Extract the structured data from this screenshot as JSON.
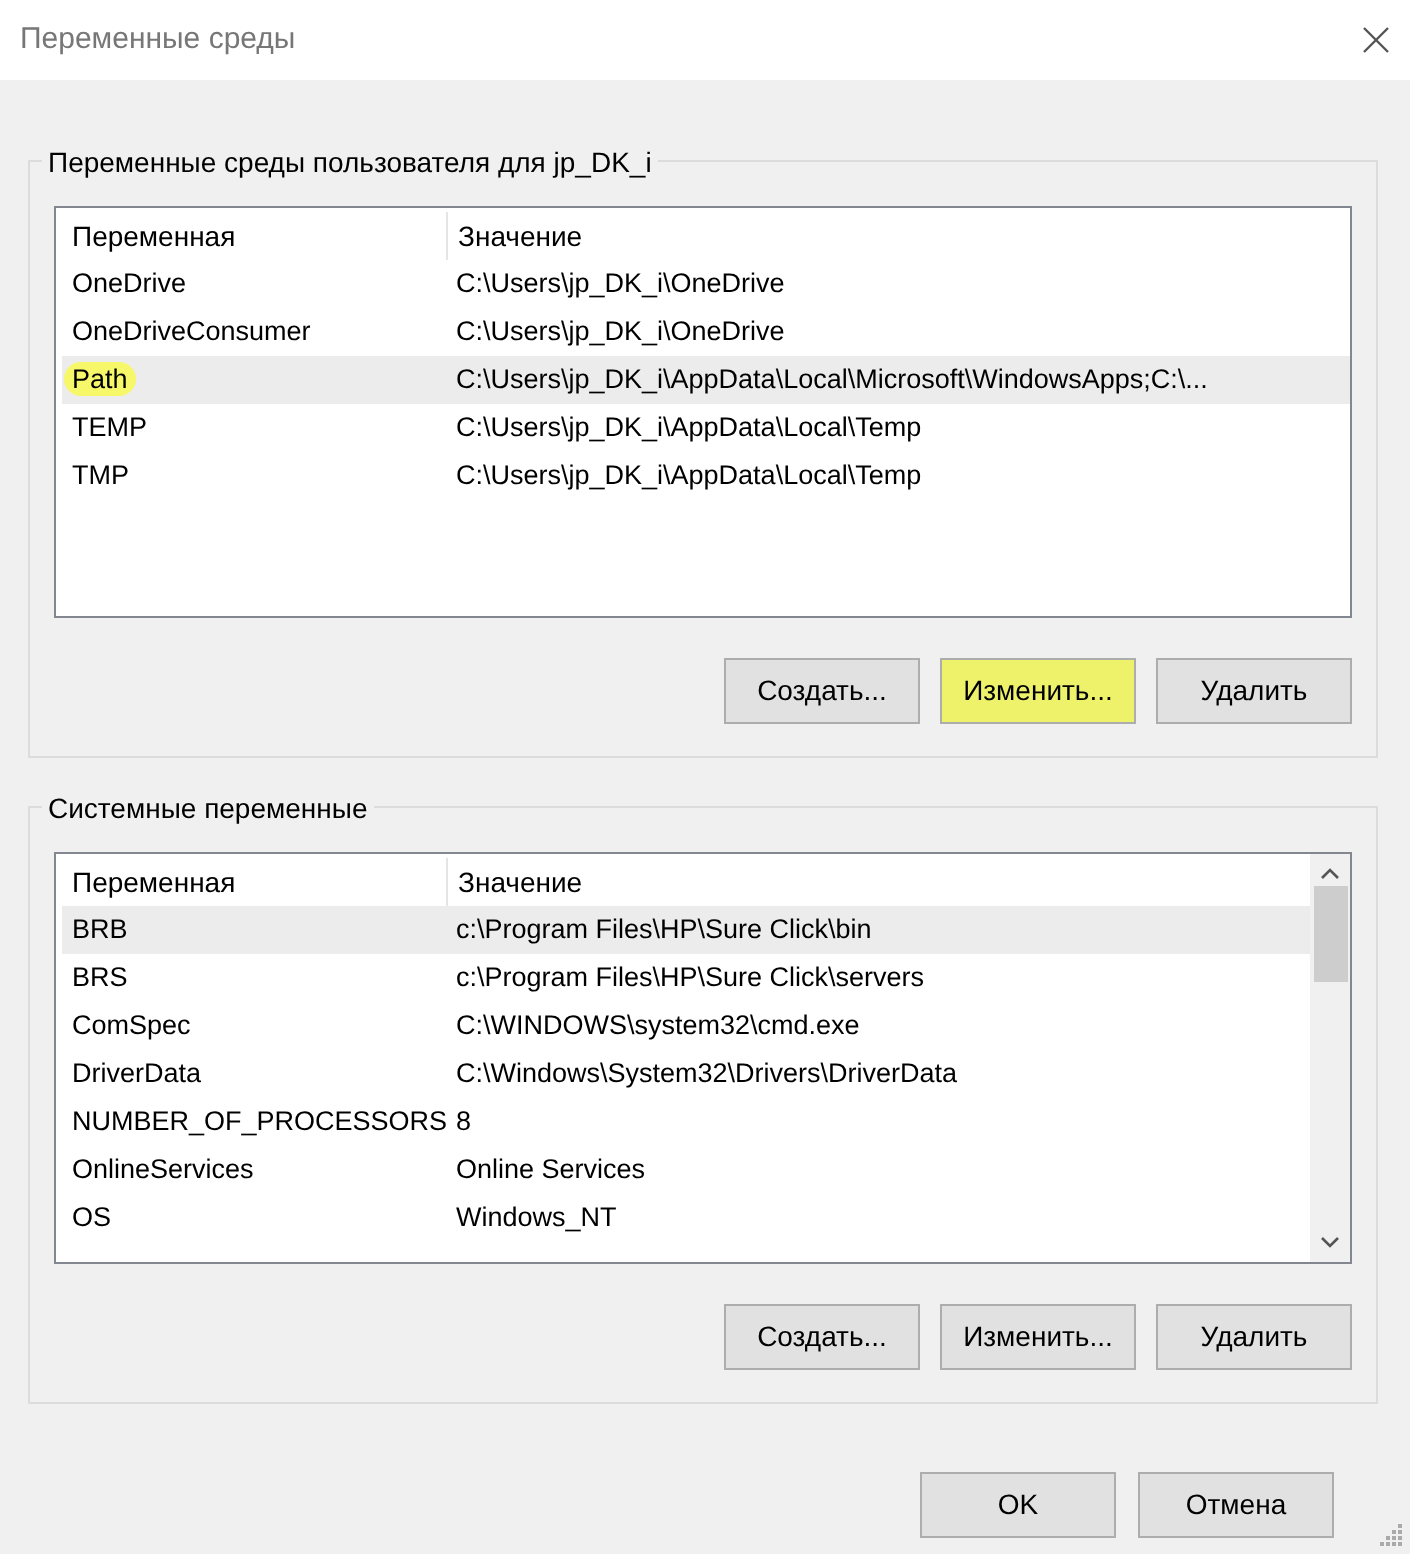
{
  "window": {
    "title": "Переменные среды"
  },
  "user_vars": {
    "title": "Переменные среды пользователя для jp_DK_i",
    "columns": [
      "Переменная",
      "Значение"
    ],
    "rows": [
      {
        "name": "OneDrive",
        "value": "C:\\Users\\jp_DK_i\\OneDrive",
        "selected": false,
        "highlighted": false
      },
      {
        "name": "OneDriveConsumer",
        "value": "C:\\Users\\jp_DK_i\\OneDrive",
        "selected": false,
        "highlighted": false
      },
      {
        "name": "Path",
        "value": "C:\\Users\\jp_DK_i\\AppData\\Local\\Microsoft\\WindowsApps;C:\\...",
        "selected": true,
        "highlighted": true
      },
      {
        "name": "TEMP",
        "value": "C:\\Users\\jp_DK_i\\AppData\\Local\\Temp",
        "selected": false,
        "highlighted": false
      },
      {
        "name": "TMP",
        "value": "C:\\Users\\jp_DK_i\\AppData\\Local\\Temp",
        "selected": false,
        "highlighted": false
      }
    ],
    "buttons": [
      {
        "label": "Создать...",
        "highlighted": false
      },
      {
        "label": "Изменить...",
        "highlighted": true
      },
      {
        "label": "Удалить",
        "highlighted": false
      }
    ]
  },
  "system_vars": {
    "title": "Системные переменные",
    "columns": [
      "Переменная",
      "Значение"
    ],
    "rows": [
      {
        "name": "BRB",
        "value": "c:\\Program Files\\HP\\Sure Click\\bin",
        "selected": true,
        "highlighted": false
      },
      {
        "name": "BRS",
        "value": "c:\\Program Files\\HP\\Sure Click\\servers",
        "selected": false,
        "highlighted": false
      },
      {
        "name": "ComSpec",
        "value": "C:\\WINDOWS\\system32\\cmd.exe",
        "selected": false,
        "highlighted": false
      },
      {
        "name": "DriverData",
        "value": "C:\\Windows\\System32\\Drivers\\DriverData",
        "selected": false,
        "highlighted": false
      },
      {
        "name": "NUMBER_OF_PROCESSORS",
        "value": "8",
        "selected": false,
        "highlighted": false
      },
      {
        "name": "OnlineServices",
        "value": "Online Services",
        "selected": false,
        "highlighted": false
      },
      {
        "name": "OS",
        "value": "Windows_NT",
        "selected": false,
        "highlighted": false
      }
    ],
    "buttons": [
      {
        "label": "Создать...",
        "highlighted": false
      },
      {
        "label": "Изменить...",
        "highlighted": false
      },
      {
        "label": "Удалить",
        "highlighted": false
      }
    ]
  },
  "footer_buttons": [
    "OK",
    "Отмена"
  ]
}
